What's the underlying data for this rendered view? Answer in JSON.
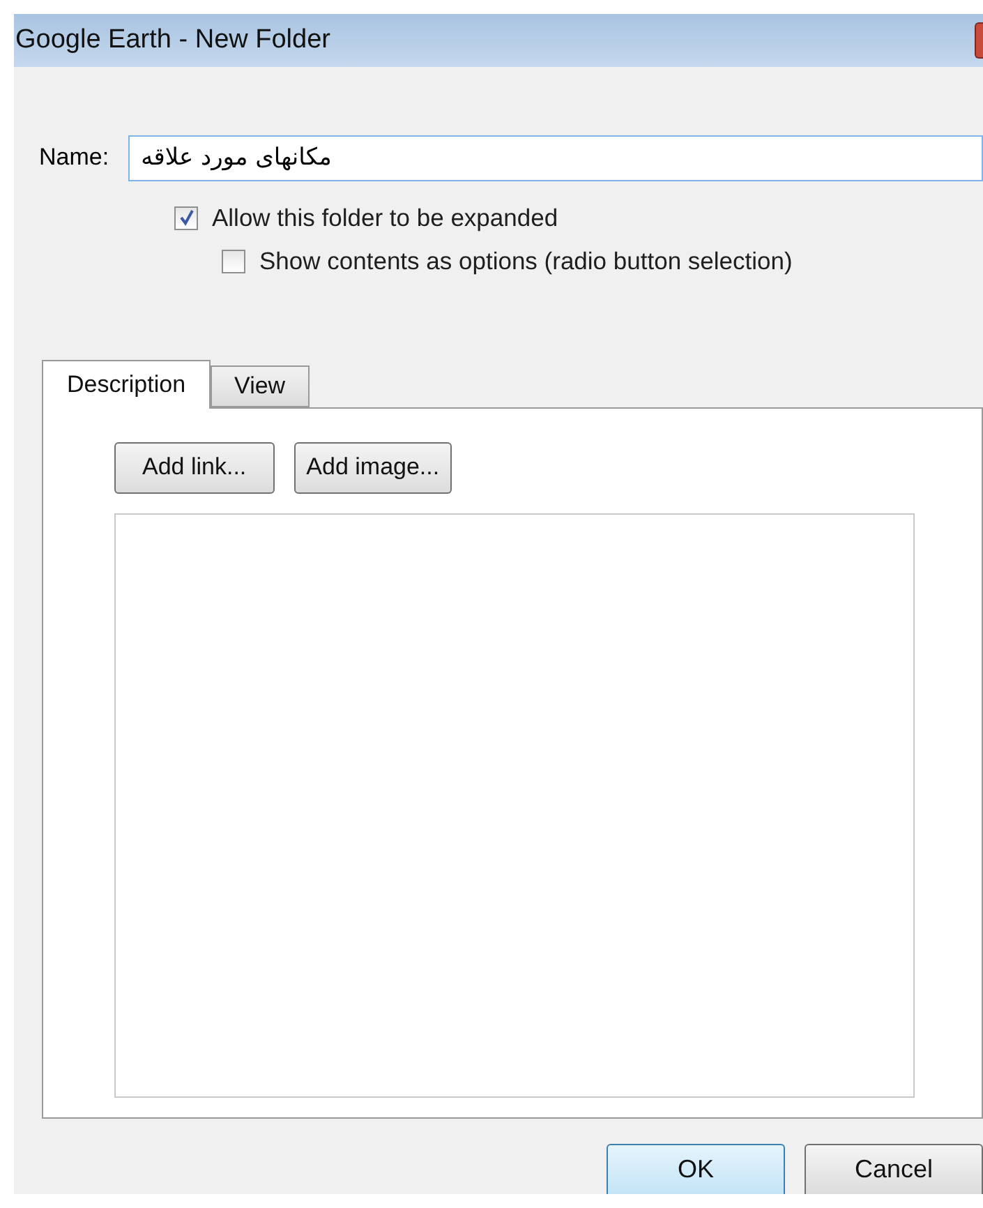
{
  "window": {
    "title": "Google Earth - New Folder"
  },
  "name_field": {
    "label": "Name:",
    "value": "مکانهای مورد علاقه"
  },
  "options": [
    {
      "label": "Allow this folder to be expanded",
      "checked": true,
      "indent": false
    },
    {
      "label": "Show contents as options (radio button selection)",
      "checked": false,
      "indent": true
    }
  ],
  "tabs": [
    {
      "label": "Description",
      "selected": true
    },
    {
      "label": "View",
      "selected": false
    }
  ],
  "description_buttons": [
    "Add link...",
    "Add image..."
  ],
  "buttons": [
    {
      "label": "OK",
      "default": true
    },
    {
      "label": "Cancel",
      "default": false
    }
  ]
}
